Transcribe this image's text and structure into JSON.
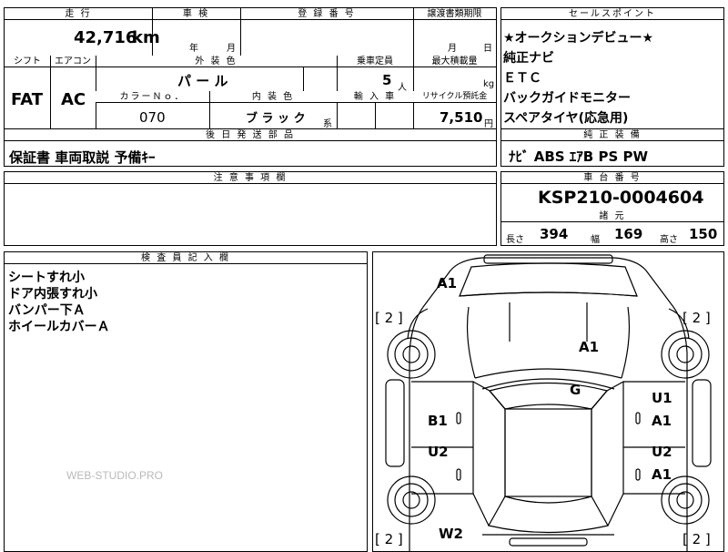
{
  "headers": {
    "mileage": "走 行",
    "inspection": "車 検",
    "registration": "登 録 番 号",
    "transfer_deadline": "譲渡書類期限",
    "sales_point": "セールスポイント",
    "shift": "シフト",
    "aircon": "エアコン",
    "exterior_color": "外 装 色",
    "capacity": "乗車定員",
    "max_load": "最大積載量",
    "color_no": "カラーＮｏ．",
    "interior_color": "内 装 色",
    "import": "輸 入 車",
    "recycle": "リサイクル預託金",
    "later_parts": "後 日 発 送 部 品",
    "standard_equipment": "純 正 装 備",
    "notes": "注 意 事 項 欄",
    "chassis_number": "車 台 番 号",
    "dimensions": "諸 元",
    "inspector_notes": "検 査 員 記 入 欄"
  },
  "vehicle": {
    "mileage": "42,716",
    "mileage_unit": "km",
    "inspection_year_label": "年",
    "inspection_month_label": "月",
    "transfer_month_label": "月",
    "transfer_day_label": "日",
    "shift": "FAT",
    "aircon": "AC",
    "exterior_color": "パ ー ル",
    "capacity": "5",
    "capacity_unit": "人",
    "max_load_unit": "kg",
    "color_no": "070",
    "interior_color": "ブ ラ ッ ク",
    "interior_color_suffix": "系",
    "recycle_fee": "7,510",
    "recycle_unit": "円",
    "later_parts": "保証書 車両取説 予備ｷｰ",
    "equipment": "ﾅﾋﾞ ABS ｴｱB PS PW",
    "chassis_number": "KSP210-0004604",
    "length_label": "長さ",
    "length": "394",
    "width_label": "幅",
    "width": "169",
    "height_label": "高さ",
    "height": "150"
  },
  "sales_points": [
    "★オークションデビュー★",
    "純正ナビ",
    "ＥＴＣ",
    "バックガイドモニター",
    "スペアタイヤ(応急用)"
  ],
  "inspector_notes": [
    "シートすれ小",
    "ドア内張すれ小",
    "バンパー下Ａ",
    "ホイールカバーＡ"
  ],
  "watermark": "WEB-STUDIO.PRO",
  "diagram": {
    "mark_front_bumper": "A1",
    "mark_hood": "A1",
    "mark_windshield": "G",
    "mark_right_front_door_1": "U1",
    "mark_right_front_door_2": "A1",
    "mark_left_front_door": "B1",
    "mark_left_rear_door": "U2",
    "mark_right_rear_door_1": "U2",
    "mark_right_rear_door_2": "A1",
    "mark_rear": "W2",
    "tire_fl": "[ 2 ]",
    "tire_fr": "[ 2 ]",
    "tire_rl": "[ 2 ]",
    "tire_rr": "[ 2 ]"
  }
}
